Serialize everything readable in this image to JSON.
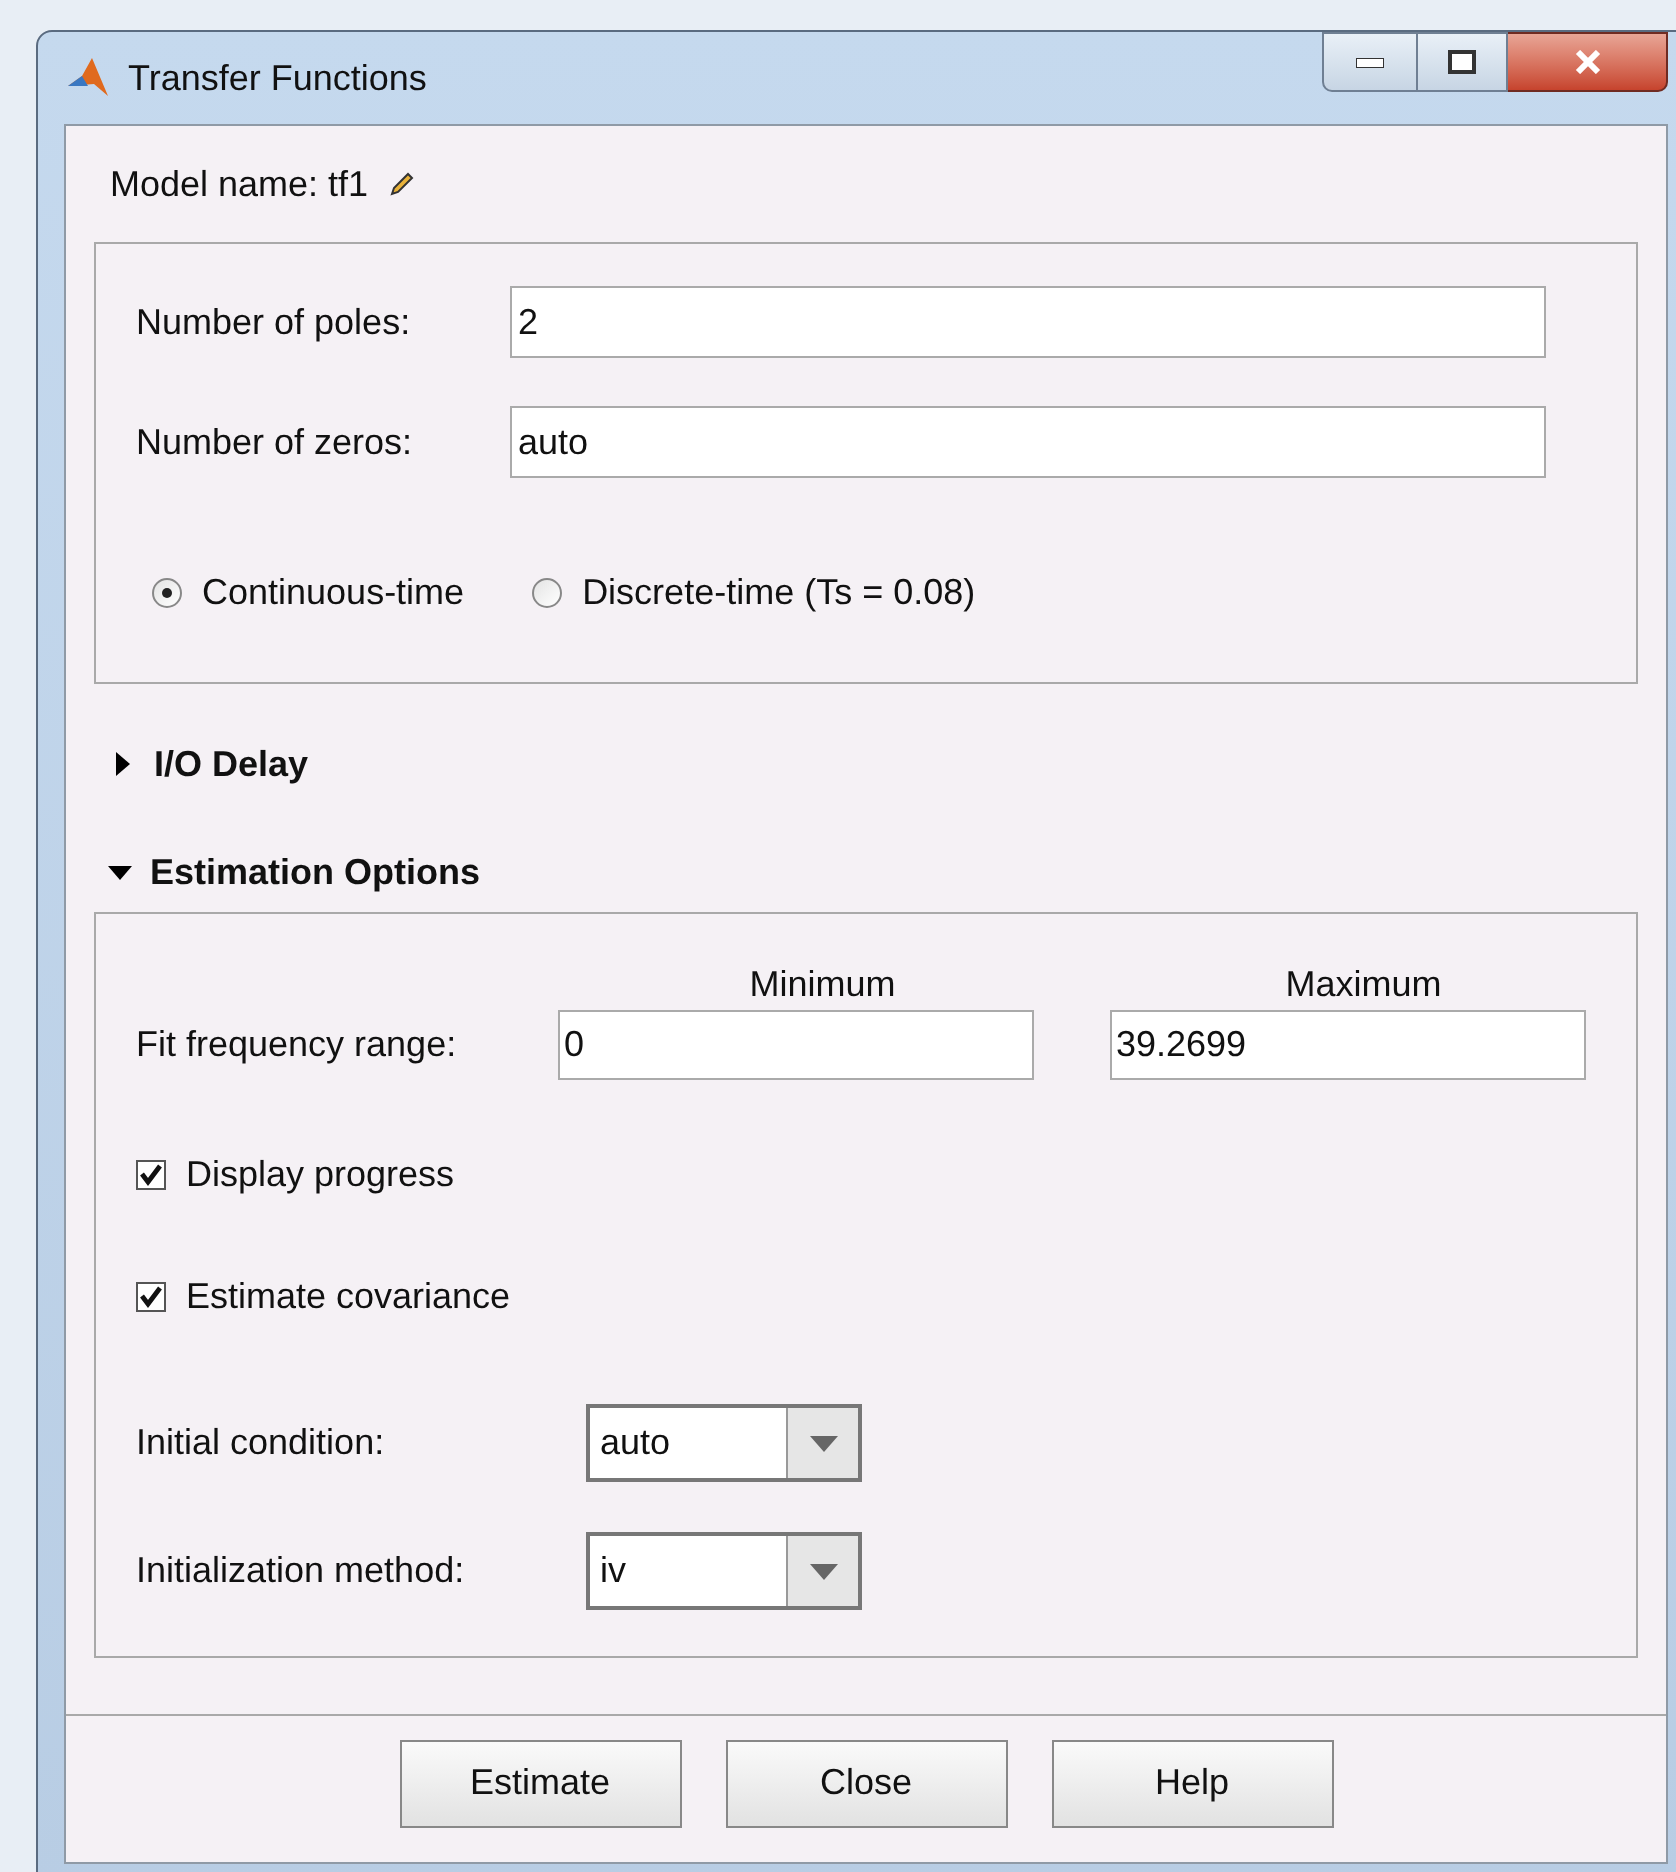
{
  "window": {
    "title": "Transfer Functions"
  },
  "model_name": {
    "label": "Model name: tf1"
  },
  "structure": {
    "fields": [
      {
        "label": "Number of poles:",
        "value": "2"
      },
      {
        "label": "Number of zeros:",
        "value": "auto"
      }
    ],
    "time_domain": [
      {
        "label": "Continuous-time",
        "selected": true
      },
      {
        "label": "Discrete-time (Ts = 0.08)",
        "selected": false
      }
    ]
  },
  "sections": [
    {
      "label": "I/O Delay",
      "expanded": false
    },
    {
      "label": "Estimation Options",
      "expanded": true
    }
  ],
  "estimation_options": {
    "column_headers": [
      "Minimum",
      "Maximum"
    ],
    "fit_frequency_range": {
      "label": "Fit frequency range:",
      "minimum": "0",
      "maximum": "39.2699"
    },
    "checkboxes": [
      {
        "label": "Display progress",
        "checked": true
      },
      {
        "label": "Estimate covariance",
        "checked": true
      }
    ],
    "dropdowns": [
      {
        "label": "Initial condition:",
        "value": "auto"
      },
      {
        "label": "Initialization method:",
        "value": "iv"
      }
    ]
  },
  "buttons": [
    "Estimate",
    "Close",
    "Help"
  ]
}
